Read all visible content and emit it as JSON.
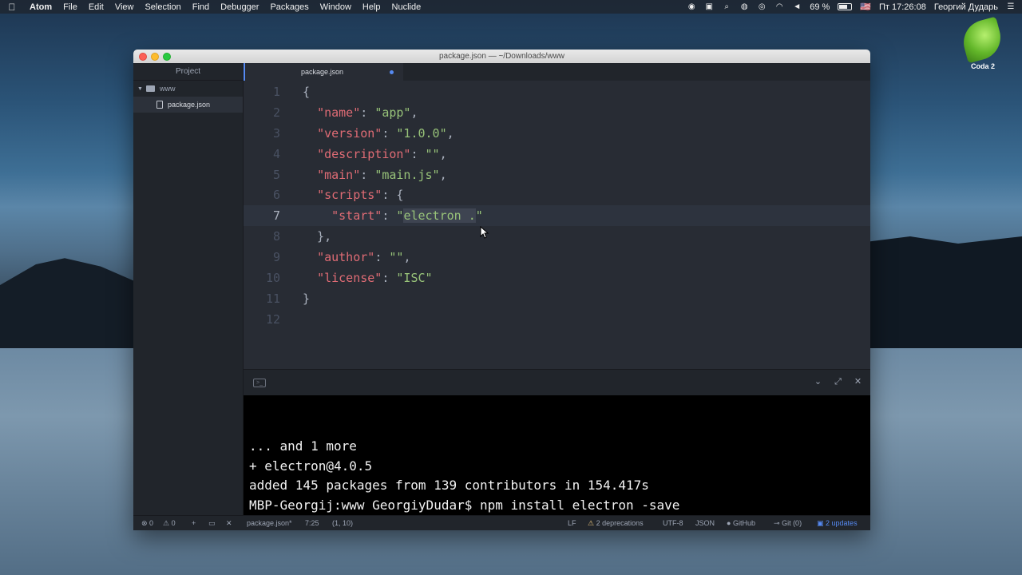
{
  "menubar": {
    "apple": "",
    "items": [
      "Atom",
      "File",
      "Edit",
      "View",
      "Selection",
      "Find",
      "Debugger",
      "Packages",
      "Window",
      "Help",
      "Nuclide"
    ],
    "battery": "69 %",
    "clock": "Пт 17:26:08",
    "user": "Георгий Дударь",
    "flag": "🇺🇸"
  },
  "desktop": {
    "icon_label": "Coda 2"
  },
  "window": {
    "title": "package.json — ~/Downloads/www"
  },
  "sidebar": {
    "header": "Project",
    "folder": "www",
    "file": "package.json"
  },
  "editor": {
    "tab": "package.json",
    "lines": [
      {
        "n": "1",
        "code": "{"
      },
      {
        "n": "2",
        "key": "\"name\"",
        "val": "\"app\"",
        "tail": ","
      },
      {
        "n": "3",
        "key": "\"version\"",
        "val": "\"1.0.0\"",
        "tail": ","
      },
      {
        "n": "4",
        "key": "\"description\"",
        "val": "\"\"",
        "tail": ","
      },
      {
        "n": "5",
        "key": "\"main\"",
        "val": "\"main.js\"",
        "tail": ","
      },
      {
        "n": "6",
        "key": "\"scripts\"",
        "val": "",
        "tail": "{"
      },
      {
        "n": "7",
        "key": "\"start\"",
        "val_pre": "\"",
        "val_sel": "electron .",
        "val_post": "\""
      },
      {
        "n": "8",
        "code": "  },"
      },
      {
        "n": "9",
        "key": "\"author\"",
        "val": "\"\"",
        "tail": ","
      },
      {
        "n": "10",
        "key": "\"license\"",
        "val": "\"ISC\"",
        "tail": ""
      },
      {
        "n": "11",
        "code": "}"
      },
      {
        "n": "12",
        "code": ""
      }
    ]
  },
  "terminal": {
    "lines": [
      "... and 1 more",
      "+ electron@4.0.5",
      "added 145 packages from 139 contributors in 154.417s",
      "MBP-Georgij:www GeorgiyDudar$ npm install electron -save"
    ]
  },
  "statusbar": {
    "errors": "0",
    "warnings": "0",
    "file": "package.json*",
    "cursor": "7:25",
    "selection": "(1, 10)",
    "eol": "LF",
    "deprecations": "2 deprecations",
    "encoding": "UTF-8",
    "grammar": "JSON",
    "github": "GitHub",
    "git": "Git (0)",
    "updates": "2 updates"
  }
}
